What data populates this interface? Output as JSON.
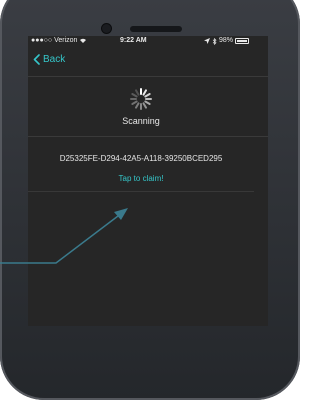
{
  "status_bar": {
    "carrier": "●●●○○ Verizon",
    "time": "9:22 AM",
    "battery": "98%"
  },
  "nav": {
    "back_label": "Back"
  },
  "scan": {
    "status_text": "Scanning",
    "device_id": "D25325FE-D294-42A5-A118-39250BCED295",
    "claim_label": "Tap to claim!"
  },
  "colors": {
    "accent": "#35c6c9",
    "screen_bg": "#262626",
    "text": "#e6e6e6",
    "annotation_arrow": "#3a7a8c"
  },
  "icons": [
    "wifi-icon",
    "location-icon",
    "bluetooth-icon",
    "battery-icon",
    "back-chevron-icon",
    "spinner-icon",
    "arrow-pointer-icon"
  ]
}
